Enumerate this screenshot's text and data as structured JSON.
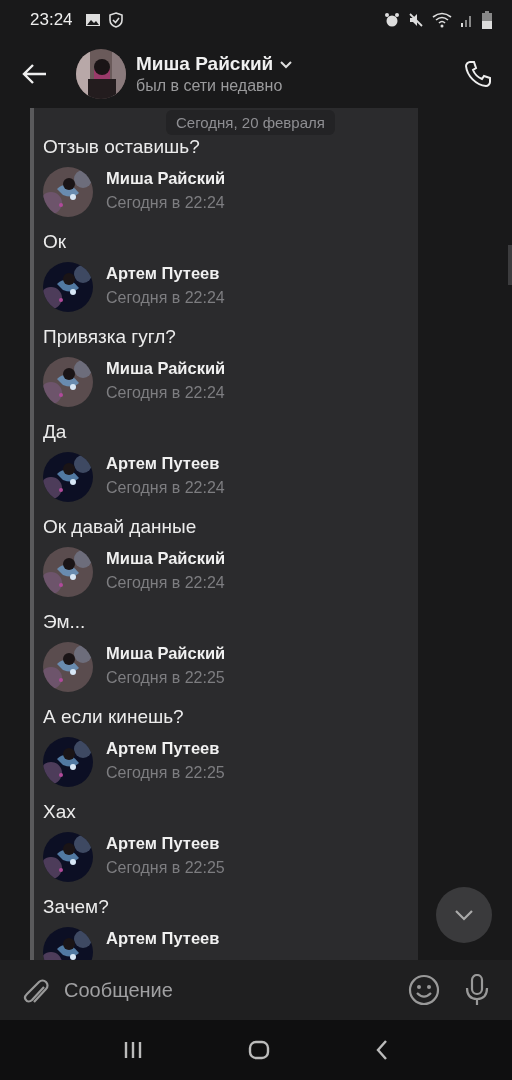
{
  "status_bar": {
    "time": "23:24"
  },
  "header": {
    "name": "Миша Райский",
    "status": "был в сети недавно"
  },
  "date_pill": "Сегодня, 20 февраля",
  "first_text": "Отзыв оставишь?",
  "messages": [
    {
      "author": "Миша Райский",
      "time": "Сегодня в 22:24",
      "color": "#5a4c4e",
      "text": "Ок"
    },
    {
      "author": "Артем Путеев",
      "time": "Сегодня в 22:24",
      "color": "#0c0f24",
      "text": "Привязка гугл?"
    },
    {
      "author": "Миша Райский",
      "time": "Сегодня в 22:24",
      "color": "#5a4c4e",
      "text": "Да"
    },
    {
      "author": "Артем Путеев",
      "time": "Сегодня в 22:24",
      "color": "#0c0f24",
      "text": "Ок давай данные"
    },
    {
      "author": "Миша Райский",
      "time": "Сегодня в 22:24",
      "color": "#5a4c4e",
      "text": "Эм..."
    },
    {
      "author": "Миша Райский",
      "time": "Сегодня в 22:25",
      "color": "#5a4c4e",
      "text": "А если кинешь?"
    },
    {
      "author": "Артем Путеев",
      "time": "Сегодня в 22:25",
      "color": "#0c0f24",
      "text": "Хах"
    },
    {
      "author": "Артем Путеев",
      "time": "Сегодня в 22:25",
      "color": "#0c0f24",
      "text": "Зачем?"
    },
    {
      "author": "Артем Путеев",
      "color": "#0c0f24"
    }
  ],
  "composer": {
    "placeholder": "Сообщение"
  }
}
